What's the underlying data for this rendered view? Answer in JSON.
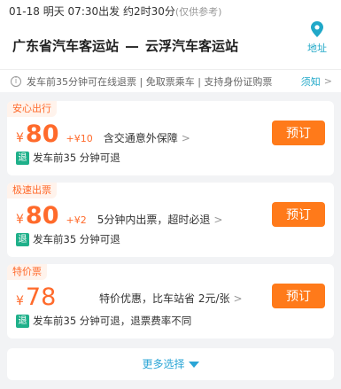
{
  "header": {
    "date": "01-18",
    "weekday": "明天",
    "departure": "07:30出发",
    "duration": "约2时30分",
    "duration_note": "(仅供参考)",
    "from_station": "广东省汽车客运站",
    "to_station": "云浮汽车客运站",
    "address_label": "地址",
    "address_icon": "location-pin-icon",
    "accent_color": "#20a8c8"
  },
  "notice": {
    "text": "发车前35分钟可在线退票 | 免取票乘车 | 支持身份证购票",
    "rules_link": "须知",
    "chevron": ">"
  },
  "tickets": [
    {
      "tag": "安心出行",
      "currency": "¥",
      "price": "80",
      "extra": "+¥10",
      "description": "含交通意外保障",
      "chevron": ">",
      "refund_badge": "退",
      "refund_text": "发车前35 分钟可退",
      "book_label": "预订"
    },
    {
      "tag": "极速出票",
      "currency": "¥",
      "price": "80",
      "extra": "+¥2",
      "description": "5分钟内出票，超时必退",
      "chevron": ">",
      "refund_badge": "退",
      "refund_text": "发车前35 分钟可退",
      "book_label": "预订"
    },
    {
      "tag": "特价票",
      "currency": "¥",
      "price": "78",
      "description": "特价优惠，比车站省 2元/张",
      "chevron": ">",
      "refund_badge": "退",
      "refund_text": "发车前35 分钟可退，退票费率不同",
      "book_label": "预订"
    }
  ],
  "more": {
    "label": "更多选择"
  },
  "colors": {
    "price": "#ff6a2b",
    "button": "#ff7a1a",
    "refund_badge": "#1fb08a",
    "link": "#2aa5d6"
  }
}
